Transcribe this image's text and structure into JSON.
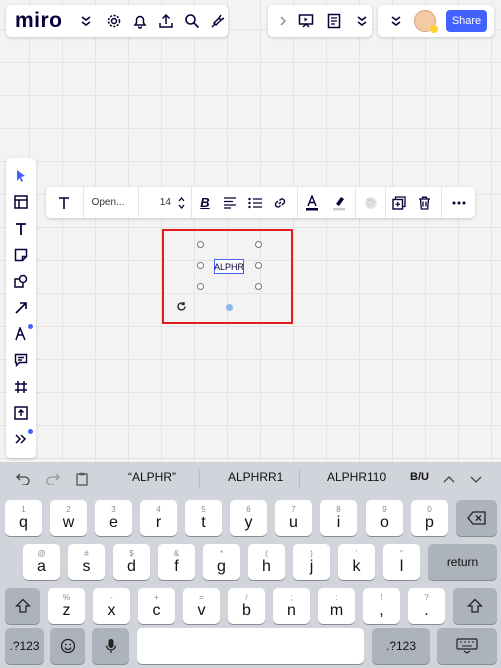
{
  "app": {
    "logo": "miro"
  },
  "topbar": {
    "left_icons": [
      "chevrons-down-icon",
      "gear-icon",
      "bell-icon",
      "upload-icon",
      "search-icon",
      "plug-icon"
    ],
    "share_label": "Share"
  },
  "left_toolbar": {
    "tools": [
      "pointer",
      "frames",
      "text",
      "sticky-note",
      "shapes",
      "line",
      "pen",
      "comment",
      "frame",
      "upload",
      "more"
    ]
  },
  "context_toolbar": {
    "font_name": "Open...",
    "font_size": "14"
  },
  "canvas": {
    "text_item": "ALPHR"
  },
  "keyboard": {
    "suggestions": [
      "“ALPHR”",
      "ALPHRR1",
      "ALPHR110"
    ],
    "format_label": "B/U",
    "row1": [
      [
        "1",
        "q"
      ],
      [
        "2",
        "w"
      ],
      [
        "3",
        "e"
      ],
      [
        "4",
        "r"
      ],
      [
        "5",
        "t"
      ],
      [
        "6",
        "y"
      ],
      [
        "7",
        "u"
      ],
      [
        "8",
        "i"
      ],
      [
        "9",
        "o"
      ],
      [
        "0",
        "p"
      ]
    ],
    "row2": [
      [
        "@",
        "a"
      ],
      [
        "#",
        "s"
      ],
      [
        "$",
        "d"
      ],
      [
        "&",
        "f"
      ],
      [
        "*",
        "g"
      ],
      [
        "(",
        "h"
      ],
      [
        ")",
        "j"
      ],
      [
        "’",
        "k"
      ],
      [
        "\"",
        "l"
      ]
    ],
    "row3": [
      [
        "%",
        "z"
      ],
      [
        "-",
        "x"
      ],
      [
        "+",
        "c"
      ],
      [
        "=",
        "v"
      ],
      [
        "/",
        "b"
      ],
      [
        ";",
        "n"
      ],
      [
        ":",
        "m"
      ],
      [
        "!",
        ","
      ],
      [
        "?",
        "."
      ]
    ],
    "return_label": "return",
    "numbers_label": ".?123"
  },
  "colors": {
    "accent": "#4262ff",
    "highlight": "#e21b1b"
  }
}
